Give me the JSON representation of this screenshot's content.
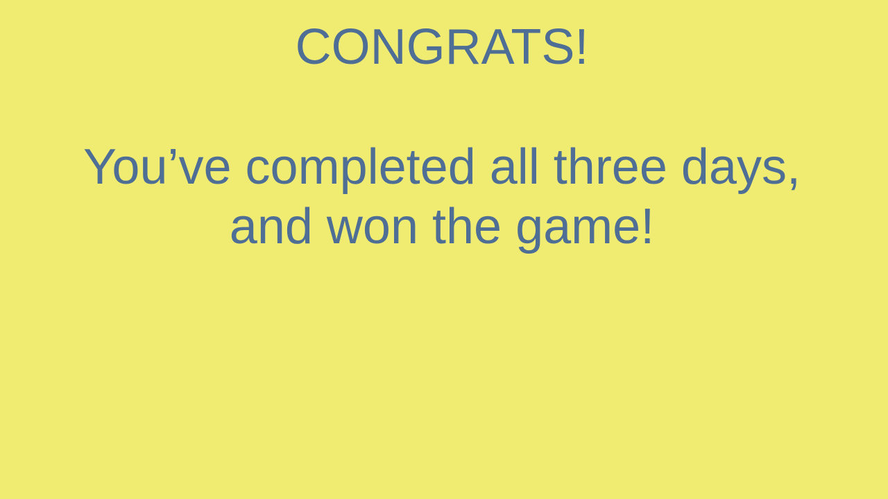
{
  "screen": {
    "title": "CONGRATS!",
    "message_line_1": "You’ve completed all three days,",
    "message_line_2": "and won the game!"
  },
  "colors": {
    "background": "#F0EC72",
    "text": "#4F6E96"
  }
}
